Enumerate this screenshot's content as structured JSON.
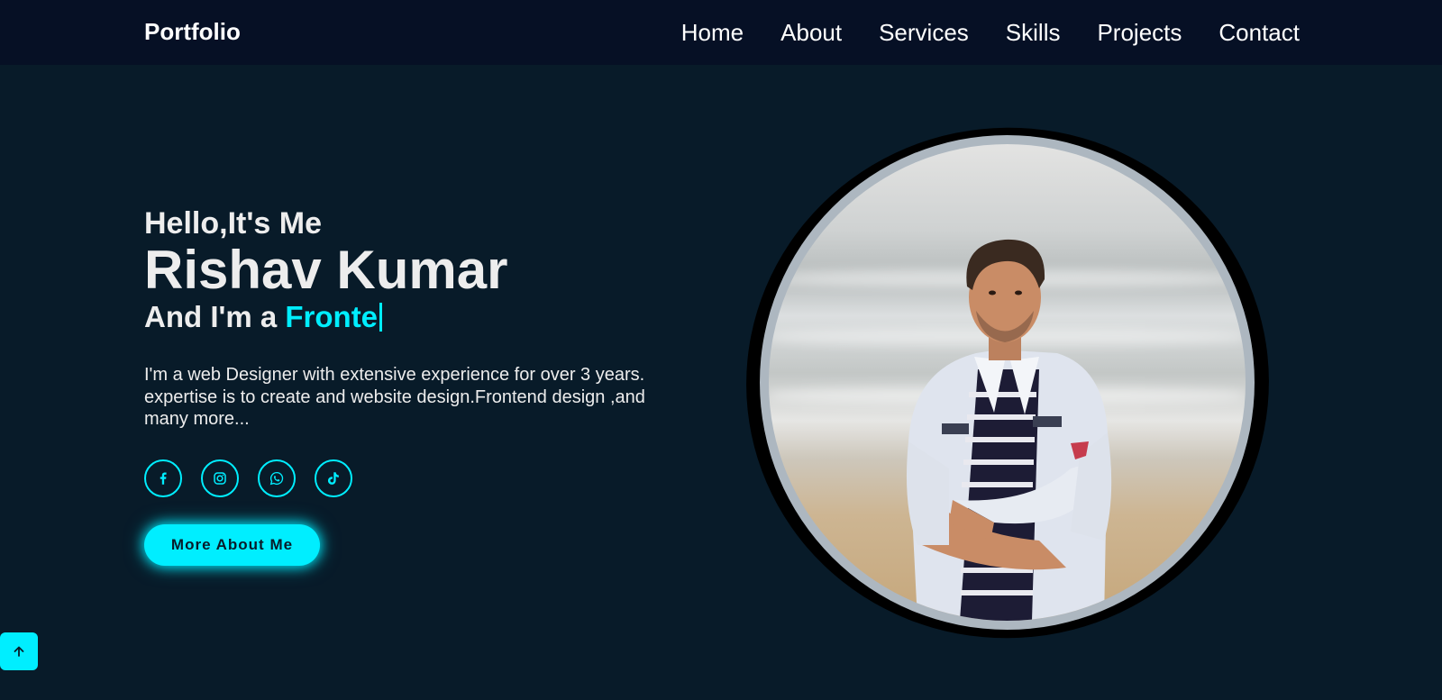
{
  "nav": {
    "logo": "Portfolio",
    "links": [
      "Home",
      "About",
      "Services",
      "Skills",
      "Projects",
      "Contact"
    ]
  },
  "hero": {
    "greeting": "Hello,It's Me",
    "name": "Rishav Kumar",
    "role_prefix": "And I'm a ",
    "role_typed": "Fronte",
    "bio": "I'm a web Designer with extensive experience for over 3 years. expertise is to create and website design.Frontend design ,and many more...",
    "button_label": "More About Me"
  },
  "socials": [
    "facebook-icon",
    "instagram-icon",
    "whatsapp-icon",
    "tiktok-icon"
  ],
  "colors": {
    "background": "#081b29",
    "navbar": "#061025",
    "accent": "#00eeff",
    "text": "#ededed"
  }
}
